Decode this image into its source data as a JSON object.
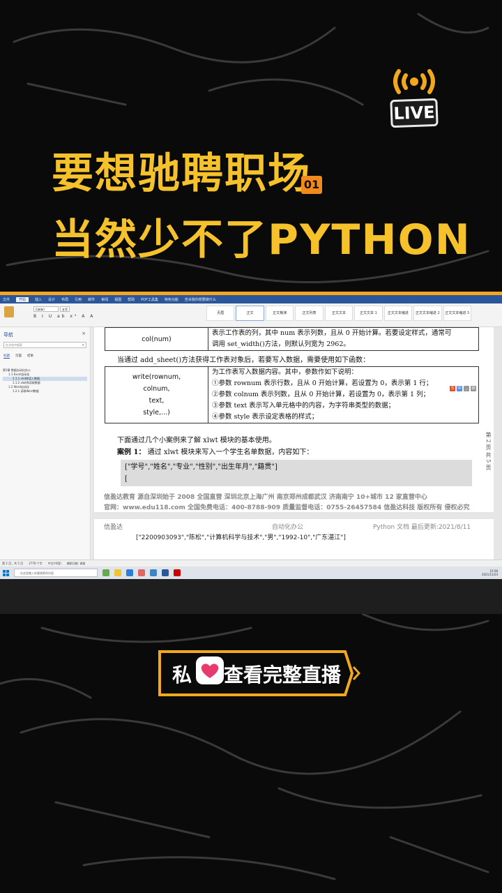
{
  "headline": {
    "line1": "要想驰聘职场",
    "badge": "01",
    "line2": "当然少不了PYTHON"
  },
  "live_badge": {
    "label": "LIVE"
  },
  "cta": {
    "prefix": "私",
    "suffix": "查看完整直播"
  },
  "word": {
    "ribbon_tabs": [
      "文件",
      "开始",
      "插入",
      "设计",
      "布局",
      "引用",
      "邮件",
      "审阅",
      "视图",
      "帮助",
      "PDF工具集",
      "特色功能",
      "告诉我你想要做什么"
    ],
    "active_tab": "开始",
    "font_name": "Calibri",
    "font_size": "五号",
    "styles": [
      "页眉",
      "正文",
      "正文格演",
      "正文列表",
      "正文文本",
      "正文文本 1",
      "正文文本缩进",
      "正文文本缩进 2",
      "正文文本缩进 3"
    ],
    "nav": {
      "title": "导航",
      "search_placeholder": "在文档中搜索",
      "tabs": [
        "标题",
        "页面",
        "结果"
      ],
      "tree": [
        "第1章 数据自动化办公",
        "1.1 Excel自动化",
        "1.1.1 xlrd库读入数据",
        "1.1.2 xlwt库读取数据",
        "1.2 Word自动化",
        "1.2.1 读取Word数据"
      ]
    },
    "table1": {
      "left": "col(num)",
      "right_1": "表示工作表的列，其中 num 表示列数，且从 0 开始计算。若要设定样式，通常可",
      "right_2": "调用 set_width()方法，则默认列宽为 2962。"
    },
    "para1": "当通过 add_sheet()方法获得工作表对象后，若要写入数据，需要使用如下函数：",
    "table2": {
      "left": [
        "write(rownum,",
        "colnum,",
        "text,",
        "style,...)"
      ],
      "right": [
        "为工作表写入数据内容。其中，参数作如下说明：",
        "①参数 rownum 表示行数，且从 0 开始计算，若设置为 0，表示第 1 行；",
        "②参数 colnum 表示列数，且从 0 开始计算，若设置为 0，表示第 1 列；",
        "③参数 text 表示写入单元格中的内容，为字符串类型的数据；",
        "④参数 style 表示设定表格的样式；"
      ]
    },
    "para2": "下面通过几个小案例来了解 xlwt 模块的基本使用。",
    "case1_label": "案例 1：",
    "case1_text": "通过 xlwt 模块来写入一个学生名单数据，内容如下：",
    "code_line1": "[\"学号\",\"姓名\",\"专业\",\"性别\",\"出生年月\",\"籍贯\"]",
    "code_line2": "[",
    "footer1": "信盈达教育  源自深圳始于 2008  全国直营  深圳北京上海广州  南京郑州成都武汉  济南南宁 10+城市 12 家直营中心",
    "footer2": "官网：www.edu118.com 全国免费电话：400-8788-909 质量监督电话：0755-26457584 信盈达科技  版权所有  侵权必究",
    "page2_header_left": "信盈达",
    "page2_header_mid": "自动化办公",
    "page2_header_right": "Python 文档  最后更新:2021/8/11",
    "page2_body": "[\"2200903093\",\"陈松\",\"计算机科学与技术\",\"男\",\"1992-10\",\"广东湛江\"]",
    "side_pages": "第 2 页  共 5 页",
    "status": [
      "第 2 页，共 5 页",
      "2778 个字",
      "中文(中国)",
      "辅助功能: 调查"
    ],
    "taskbar_search": "在这里输入你要搜索的内容",
    "clock_time": "15:08",
    "clock_date": "2021/11/24"
  }
}
